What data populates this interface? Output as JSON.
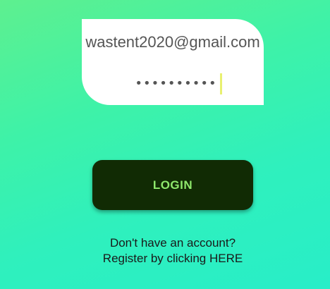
{
  "login_form": {
    "email_value": "wastent2020@gmail.com",
    "password_masked": "••••••••••"
  },
  "login_button": {
    "label": "LOGIN"
  },
  "register": {
    "line1": "Don't have an account?",
    "line2": "Register by clicking HERE"
  },
  "colors": {
    "background_top": "#5ef08f",
    "background_bottom": "#28eec8",
    "button_bg": "#112b04",
    "button_text": "#8fe86c",
    "cursor": "#e8f070"
  }
}
